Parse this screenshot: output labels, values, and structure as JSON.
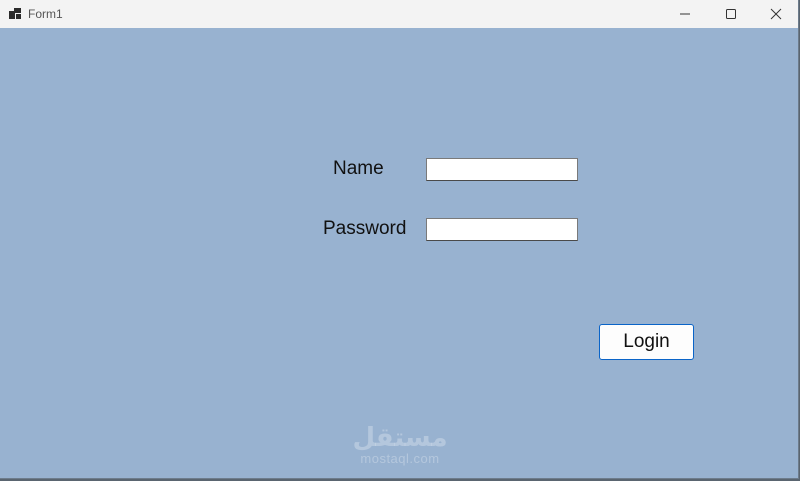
{
  "window": {
    "title": "Form1",
    "icon": "app-window-icon",
    "controls": [
      "minimize-icon",
      "maximize-icon",
      "close-icon"
    ],
    "background_color": "#98b2d0"
  },
  "form": {
    "name_label": "Name",
    "name_value": "",
    "password_label": "Password",
    "password_value": "",
    "login_button": "Login",
    "accent_color": "#0a64c8"
  },
  "watermark": {
    "arabic": "مستقل",
    "latin": "mostaql.com"
  }
}
